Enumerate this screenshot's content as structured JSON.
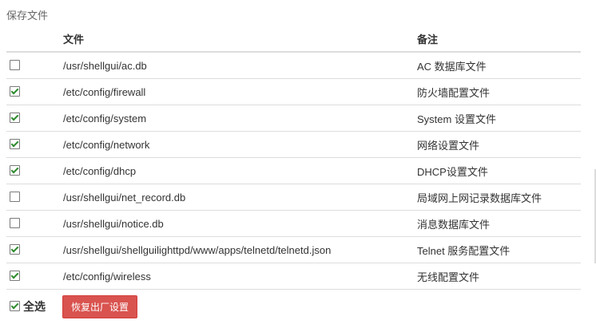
{
  "section_title": "保存文件",
  "table": {
    "headers": {
      "file": "文件",
      "note": "备注"
    },
    "rows": [
      {
        "checked": false,
        "file": "/usr/shellgui/ac.db",
        "note": "AC 数据库文件"
      },
      {
        "checked": true,
        "file": "/etc/config/firewall",
        "note": "防火墙配置文件"
      },
      {
        "checked": true,
        "file": "/etc/config/system",
        "note": "System 设置文件"
      },
      {
        "checked": true,
        "file": "/etc/config/network",
        "note": "网络设置文件"
      },
      {
        "checked": true,
        "file": "/etc/config/dhcp",
        "note": "DHCP设置文件"
      },
      {
        "checked": false,
        "file": "/usr/shellgui/net_record.db",
        "note": "局域网上网记录数据库文件"
      },
      {
        "checked": false,
        "file": "/usr/shellgui/notice.db",
        "note": "消息数据库文件"
      },
      {
        "checked": true,
        "file": "/usr/shellgui/shellguilighttpd/www/apps/telnetd/telnetd.json",
        "note": "Telnet 服务配置文件"
      },
      {
        "checked": true,
        "file": "/etc/config/wireless",
        "note": "无线配置文件"
      }
    ]
  },
  "footer": {
    "select_all_label": "全选",
    "select_all_checked": true,
    "reset_button_label": "恢复出厂设置"
  },
  "colors": {
    "danger": "#d9534f",
    "checkmark": "#2e8b2e",
    "border": "#dddddd"
  }
}
